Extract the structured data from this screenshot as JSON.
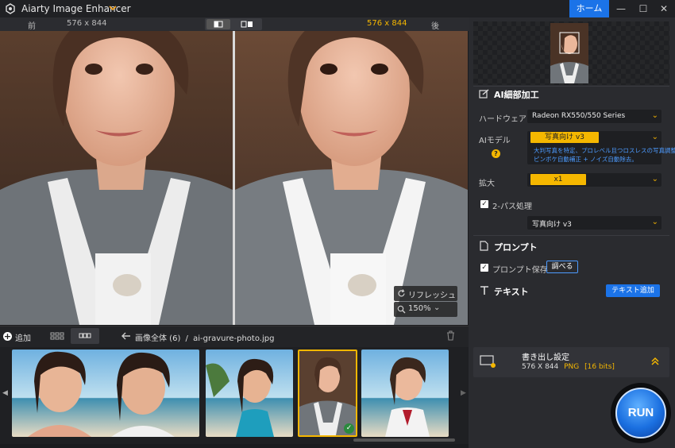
{
  "app": {
    "title": "Aiarty Image Enhancer",
    "home": "ホーム"
  },
  "window": {
    "minimize": "—",
    "maximize": "☐",
    "close": "✕"
  },
  "compare": {
    "before_label": "前",
    "before_size": "576 x 844",
    "after_size": "576 x 844",
    "after_label": "後"
  },
  "preview": {
    "refresh": "リフレッシュ",
    "zoom": "150%"
  },
  "toolbar": {
    "add": "追加",
    "path_root": "画像全体 (6)",
    "path_sep": "/",
    "filename": "ai-gravure-photo.jpg"
  },
  "panel": {
    "section_title": "AI細部加工",
    "hardware_label": "ハードウェア",
    "hardware_value": "Radeon RX550/550 Series",
    "model_label": "AIモデル",
    "model_value": "写真向け v3",
    "model_help": "?",
    "model_desc_1": "大判写真を特定、プロレベル且つロスレスの写真調整。",
    "model_desc_2": "ピンボケ自動補正 + ノイズ自動除去。",
    "scale_label": "拡大",
    "scale_value": "x1",
    "twopass_label": "2-パス処理",
    "twopass_value": "写真向け v3",
    "prompt_title": "プロンプト",
    "prompt_save": "プロンプト保存",
    "prompt_check": "調べる",
    "text_title": "テキスト",
    "text_add": "テキスト追加"
  },
  "export": {
    "title": "書き出し設定",
    "size": "576 X 844",
    "format": "PNG",
    "bits": "[16 bits]"
  },
  "run": "RUN",
  "colors": {
    "accent": "#f5b700",
    "blue": "#1b73e8",
    "bg": "#1b1c1f"
  }
}
